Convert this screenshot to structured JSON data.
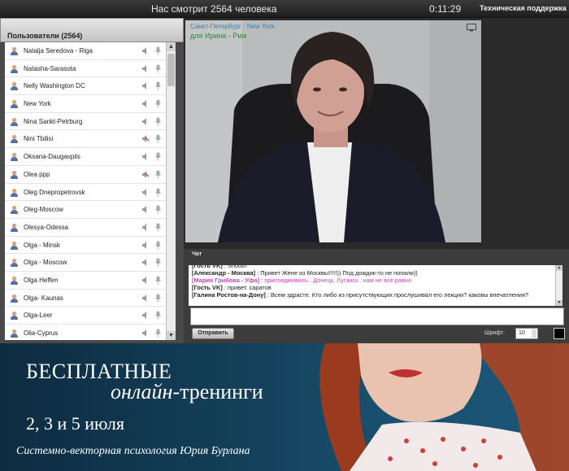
{
  "topbar": {
    "viewers": "Нас смотрит 2564 человека",
    "timer": "0:11:29",
    "support": "Техническая поддержка"
  },
  "users_panel": {
    "title": "Пользователи (2564)",
    "users": [
      {
        "name": "Natalja Seredova - Riga",
        "muted": false
      },
      {
        "name": "Natasha-Sarasota",
        "muted": false
      },
      {
        "name": "Nelly Washington DC",
        "muted": false
      },
      {
        "name": "New York",
        "muted": false
      },
      {
        "name": "Nina  Sankt-Petrburg",
        "muted": false
      },
      {
        "name": "Nini    Tbilisi",
        "muted": true
      },
      {
        "name": "Oksana-Daugavpils",
        "muted": false
      },
      {
        "name": "Olea ppp",
        "muted": true
      },
      {
        "name": "Oleg Dnepropetrovsk",
        "muted": false
      },
      {
        "name": "Oleg-Moscow",
        "muted": false
      },
      {
        "name": "Olesya-Odessa",
        "muted": false
      },
      {
        "name": "Olga - Minsk",
        "muted": false
      },
      {
        "name": "Olga - Moscow",
        "muted": false
      },
      {
        "name": "Olga Heffen",
        "muted": false
      },
      {
        "name": "Olga- Kaunas",
        "muted": false
      },
      {
        "name": "Olga-Leer",
        "muted": false
      },
      {
        "name": "Olia-Cyprus",
        "muted": false
      }
    ]
  },
  "video": {
    "caption_top": "Санкт-Петербург · New York",
    "caption": "для Ирина - Рим"
  },
  "chat": {
    "title": "Чат",
    "messages": [
      {
        "author": "[Гость VK]",
        "text": "Shouth",
        "pink": false
      },
      {
        "author": "[Александр - Москва]",
        "text": "Привет Жене из Москвы!!!!!)) Под дождик-то не попали))",
        "pink": false
      },
      {
        "author": "[Мария Грибова - Уфа]",
        "text": "присоединяюсь.. Донецк, Луганск.. нам не все равно",
        "pink": true
      },
      {
        "author": "[Гость VK]",
        "text": "привет. саратов",
        "pink": false
      },
      {
        "author": "[Галина Ростов-на-Дону]",
        "text": "Всем здрасте. Кто либо из присутствующих прослушивал его лекции? каковы впечатления?",
        "pink": false
      }
    ],
    "input_value": "",
    "send_label": "Отправить",
    "font_label": "Шрифт:",
    "font_size": "10"
  },
  "banner": {
    "line1": "БЕСПЛАТНЫЕ",
    "line2_italic": "онлайн-",
    "line2_rest": "тренинги",
    "dates": "2, 3 и 5 июля",
    "signature": "Системно-векторная психология Юрия Бурлана"
  },
  "colors": {
    "pink_author": "#d23dbf",
    "caption_green": "#2f8a2f",
    "banner_bg": "#14415c"
  }
}
